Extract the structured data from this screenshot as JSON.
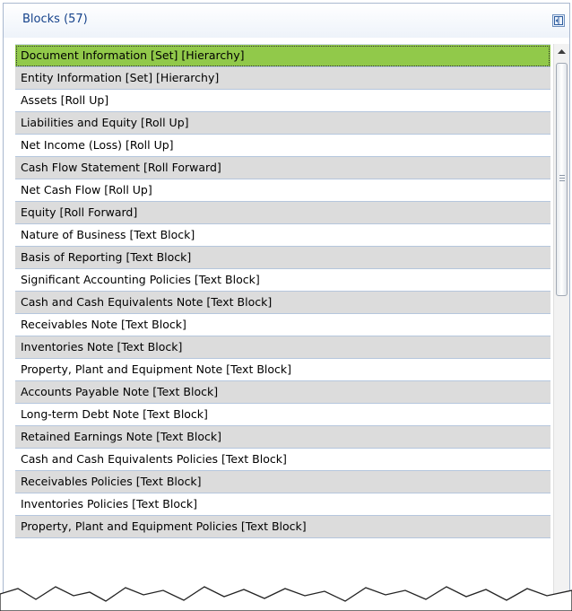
{
  "panel": {
    "title": "Blocks (57)",
    "collapse_icon": "collapse-panel-icon"
  },
  "blocks": [
    "Document Information [Set] [Hierarchy]",
    "Entity Information [Set] [Hierarchy]",
    "Assets [Roll Up]",
    "Liabilities and Equity [Roll Up]",
    "Net Income (Loss) [Roll Up]",
    "Cash Flow Statement [Roll Forward]",
    "Net Cash Flow [Roll Up]",
    "Equity [Roll Forward]",
    "Nature of Business [Text Block]",
    "Basis of Reporting [Text Block]",
    "Significant Accounting Policies [Text Block]",
    "Cash and Cash Equivalents Note [Text Block]",
    "Receivables Note [Text Block]",
    "Inventories Note [Text Block]",
    "Property, Plant and Equipment Note [Text Block]",
    "Accounts Payable Note [Text Block]",
    "Long-term Debt Note [Text Block]",
    "Retained Earnings Note [Text Block]",
    "Cash and Cash Equivalents Policies [Text Block]",
    "Receivables Policies [Text Block]",
    "Inventories Policies [Text Block]",
    "Property, Plant and Equipment Policies [Text Block]"
  ],
  "selected_index": 0,
  "colors": {
    "selected": "#91c94a",
    "alt_row": "#dcdcdc",
    "header_text": "#15428b"
  }
}
